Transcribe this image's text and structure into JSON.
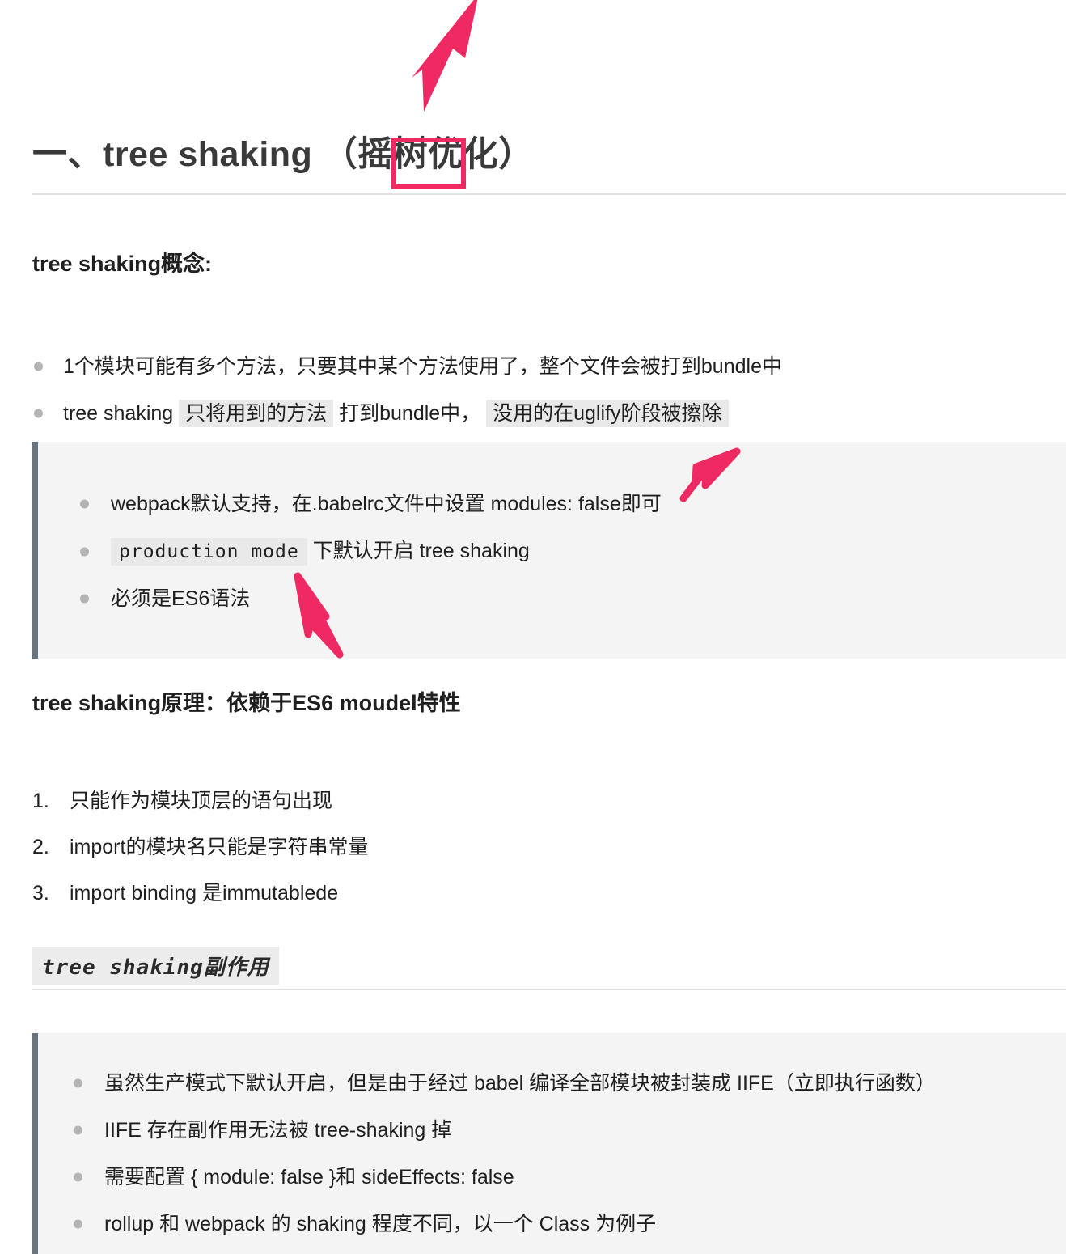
{
  "document": {
    "title": "一、tree shaking （摇树优化）",
    "headings": {
      "concept": "tree shaking概念:",
      "principle": "tree shaking原理：依赖于ES6 moudel特性",
      "side_effects_code": "tree shaking副作用"
    },
    "concept_list": [
      {
        "parts": [
          {
            "type": "text",
            "value": "1个模块可能有多个方法，只要其中某个方法使用了，整个文件会被打到bundle中"
          }
        ]
      },
      {
        "parts": [
          {
            "type": "text",
            "value": "tree shaking "
          },
          {
            "type": "code",
            "value": "只将用到的方法"
          },
          {
            "type": "text",
            "value": " 打到bundle中，  "
          },
          {
            "type": "code",
            "value": "没用的在uglify阶段被擦除"
          }
        ]
      }
    ],
    "quote_top": {
      "items": [
        {
          "parts": [
            {
              "type": "text",
              "value": "webpack默认支持，在.babelrc文件中设置 modules: false即可"
            }
          ]
        },
        {
          "parts": [
            {
              "type": "code-mono",
              "value": "production mode"
            },
            {
              "type": "text",
              "value": " 下默认开启 tree shaking"
            }
          ]
        },
        {
          "parts": [
            {
              "type": "text",
              "value": "必须是ES6语法"
            }
          ]
        }
      ]
    },
    "principle_list": [
      {
        "number": "1.",
        "text": "只能作为模块顶层的语句出现"
      },
      {
        "number": "2.",
        "text": "import的模块名只能是字符串常量"
      },
      {
        "number": "3.",
        "text": "import binding 是immutablede"
      }
    ],
    "quote_bottom": {
      "items": [
        {
          "parts": [
            {
              "type": "text",
              "value": "虽然生产模式下默认开启，但是由于经过 babel 编译全部模块被封装成 IIFE（立即执行函数）"
            }
          ]
        },
        {
          "parts": [
            {
              "type": "text",
              "value": "IIFE 存在副作用无法被 tree-shaking 掉"
            }
          ]
        },
        {
          "parts": [
            {
              "type": "text",
              "value": "需要配置 { module: false }和 sideEffects: false"
            }
          ]
        },
        {
          "parts": [
            {
              "type": "text",
              "value": "rollup 和 webpack 的 shaking 程度不同，以一个 Class 为例子"
            }
          ]
        }
      ]
    }
  },
  "annotations": {
    "color": "#ef2a63",
    "highlight_box": {
      "label": "摇树-highlight"
    },
    "arrows": [
      {
        "name": "arrow-to-title",
        "target": "摇树"
      },
      {
        "name": "arrow-to-modules-false",
        "target": "modules: false即可"
      },
      {
        "name": "arrow-to-production-mode",
        "target": "production mode"
      }
    ]
  },
  "colors": {
    "accent_pink": "#ef2a63",
    "quote_border": "#66757f",
    "quote_background": "#f4f4f4",
    "code_background": "#e9e9e9",
    "text": "#1f1f1f",
    "rule": "#e3e3e3"
  }
}
